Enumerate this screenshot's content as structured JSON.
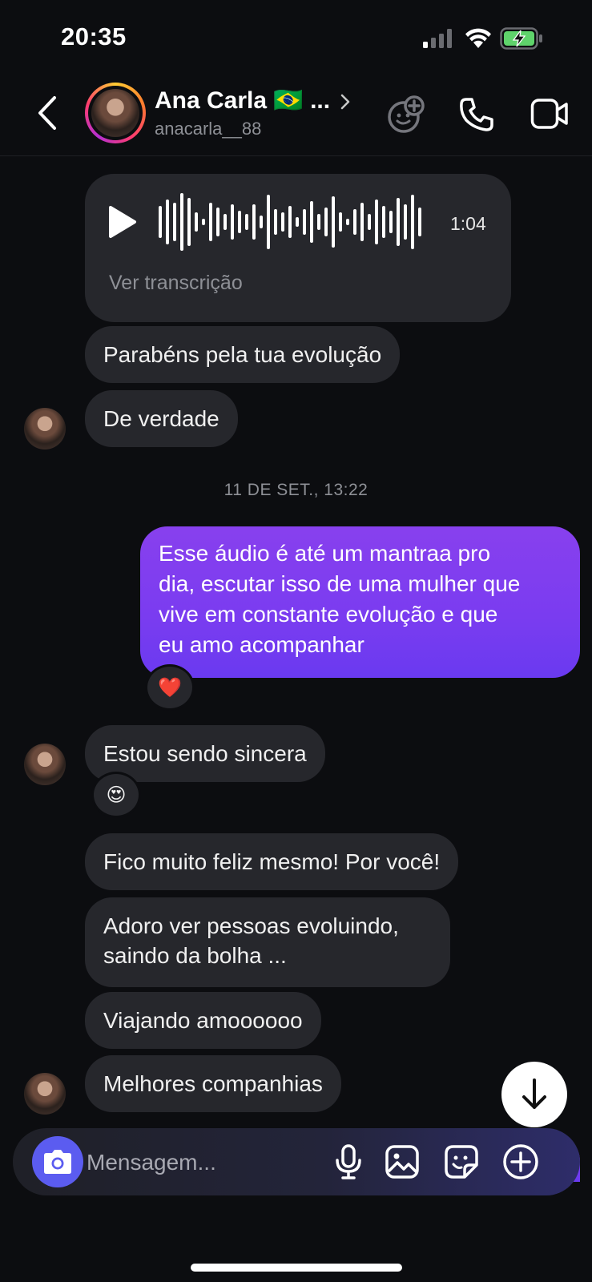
{
  "status_bar": {
    "time": "20:35"
  },
  "header": {
    "name": "Ana Carla 🇧🇷 ...",
    "handle": "anacarla__88"
  },
  "audio_message": {
    "duration": "1:04",
    "transcription_link": "Ver transcrição"
  },
  "messages": {
    "m1": "Parabéns pela tua evolução",
    "m2": "De verdade",
    "date_separator": "11 DE SET., 13:22",
    "sent1_line1": "Esse áudio é até um mantraa pro",
    "sent1_line2": "dia, escutar isso de uma mulher que",
    "sent1_line3": "vive em constante evolução e que",
    "sent1_line4": "eu amo acompanhar",
    "sent1_reaction": "❤️",
    "m3": "Estou sendo sincera",
    "m3_reaction": "😍",
    "m4": "Fico muito feliz mesmo! Por você!",
    "m5_line1": "Adoro ver pessoas evoluindo,",
    "m5_line2": "saindo da bolha ...",
    "m6": "Viajando amoooooo",
    "m7": "Melhores companhias"
  },
  "composer": {
    "placeholder": "Mensagem..."
  },
  "icons": [
    "back-icon",
    "profile-chevron-icon",
    "avatar-game-icon",
    "phone-icon",
    "video-icon",
    "play-icon",
    "camera-icon",
    "microphone-icon",
    "gallery-icon",
    "sticker-icon",
    "plus-icon",
    "arrow-down-icon",
    "signal-icon",
    "wifi-icon",
    "battery-icon"
  ],
  "colors": {
    "accent_purple": "#7a3cf0",
    "camera_blue": "#5b5cf0",
    "bubble_gray": "#26272c"
  }
}
